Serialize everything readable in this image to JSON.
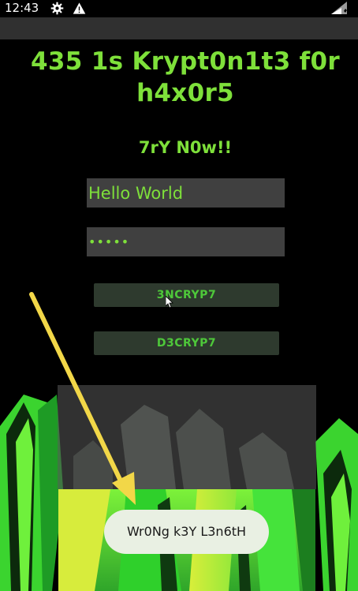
{
  "status_bar": {
    "time": "12:43",
    "icons": [
      "gear-icon",
      "warning-icon",
      "signal-icon"
    ]
  },
  "app": {
    "title": "435 1s Krypt0n1t3 f0r h4x0r5",
    "subtitle": "7rY N0w!!"
  },
  "form": {
    "text_value": "Hello World",
    "key_value": "•••••",
    "encrypt_label": "3NCRYP7",
    "decrypt_label": "D3CRYP7"
  },
  "toast": {
    "message": "Wr0Ng k3Y L3n6tH"
  },
  "colors": {
    "accent": "#7ee03a",
    "button_text": "#4ec83a",
    "button_bg": "#2e3a2e",
    "input_bg": "#404040",
    "arrow": "#f2d748",
    "toast_bg": "#e9f0e3"
  }
}
